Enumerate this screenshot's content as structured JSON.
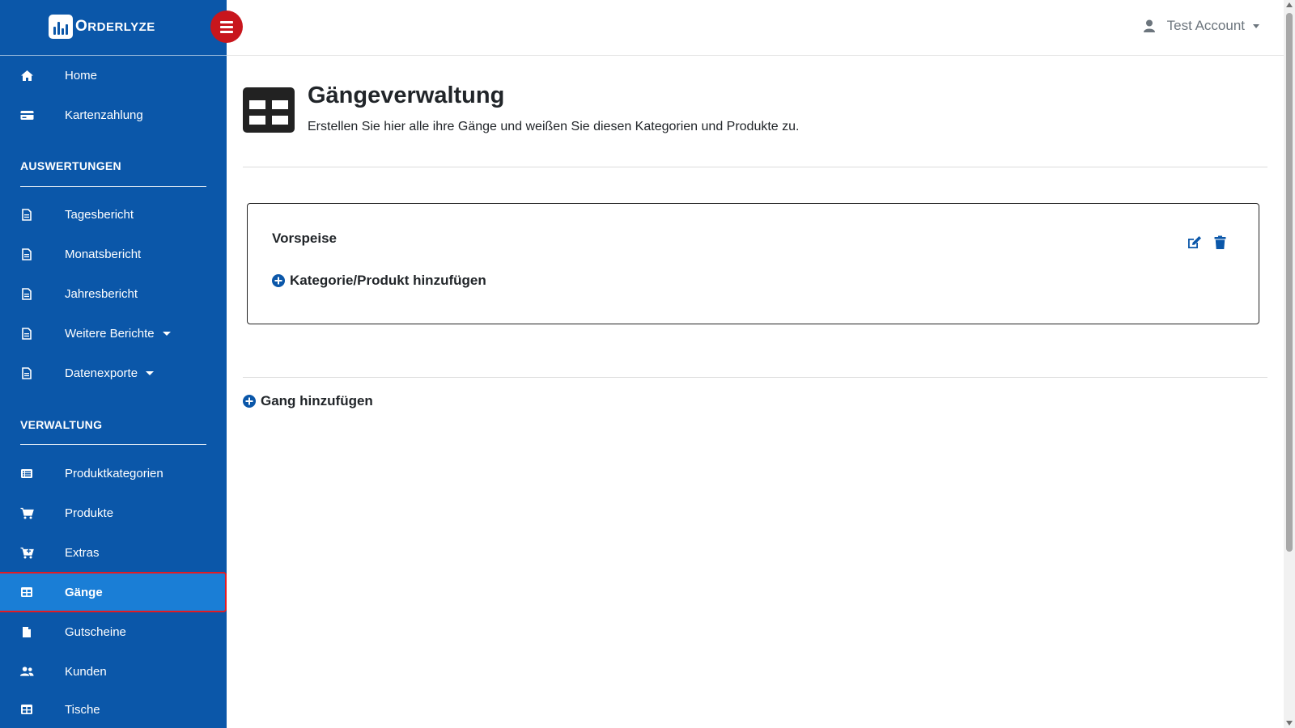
{
  "brand": {
    "name": "ORDERLYZE",
    "first_letter": "O",
    "rest": "RDERLYZE"
  },
  "header": {
    "account_name": "Test Account"
  },
  "sidebar": {
    "top_items": [
      {
        "label": "Home",
        "icon": "home-icon"
      },
      {
        "label": "Kartenzahlung",
        "icon": "credit-card-icon"
      }
    ],
    "sections": [
      {
        "title": "AUSWERTUNGEN",
        "items": [
          {
            "label": "Tagesbericht",
            "icon": "file-text-icon"
          },
          {
            "label": "Monatsbericht",
            "icon": "file-text-icon"
          },
          {
            "label": "Jahresbericht",
            "icon": "file-text-icon"
          },
          {
            "label": "Weitere Berichte",
            "icon": "file-text-icon",
            "has_dropdown": true
          },
          {
            "label": "Datenexporte",
            "icon": "file-text-icon",
            "has_dropdown": true
          }
        ]
      },
      {
        "title": "VERWALTUNG",
        "items": [
          {
            "label": "Produktkategorien",
            "icon": "list-icon"
          },
          {
            "label": "Produkte",
            "icon": "cart-icon"
          },
          {
            "label": "Extras",
            "icon": "cart-plus-icon"
          },
          {
            "label": "Gänge",
            "icon": "table-icon",
            "active": true
          },
          {
            "label": "Gutscheine",
            "icon": "file-icon"
          },
          {
            "label": "Kunden",
            "icon": "users-icon"
          },
          {
            "label": "Tische",
            "icon": "table-icon"
          }
        ]
      }
    ]
  },
  "page": {
    "title": "Gängeverwaltung",
    "subtitle": "Erstellen Sie hier alle ihre Gänge und weißen Sie diesen Kategorien und Produkte zu.",
    "icon": "table-icon"
  },
  "courses": [
    {
      "name": "Vorspeise",
      "add_label": "Kategorie/Produkt hinzufügen"
    }
  ],
  "actions": {
    "add_course_label": "Gang hinzufügen"
  },
  "colors": {
    "sidebar": "#0b57a9",
    "active_item": "#1a7ed6",
    "menu_toggle": "#c8161d",
    "highlight_border": "#e31b23"
  }
}
